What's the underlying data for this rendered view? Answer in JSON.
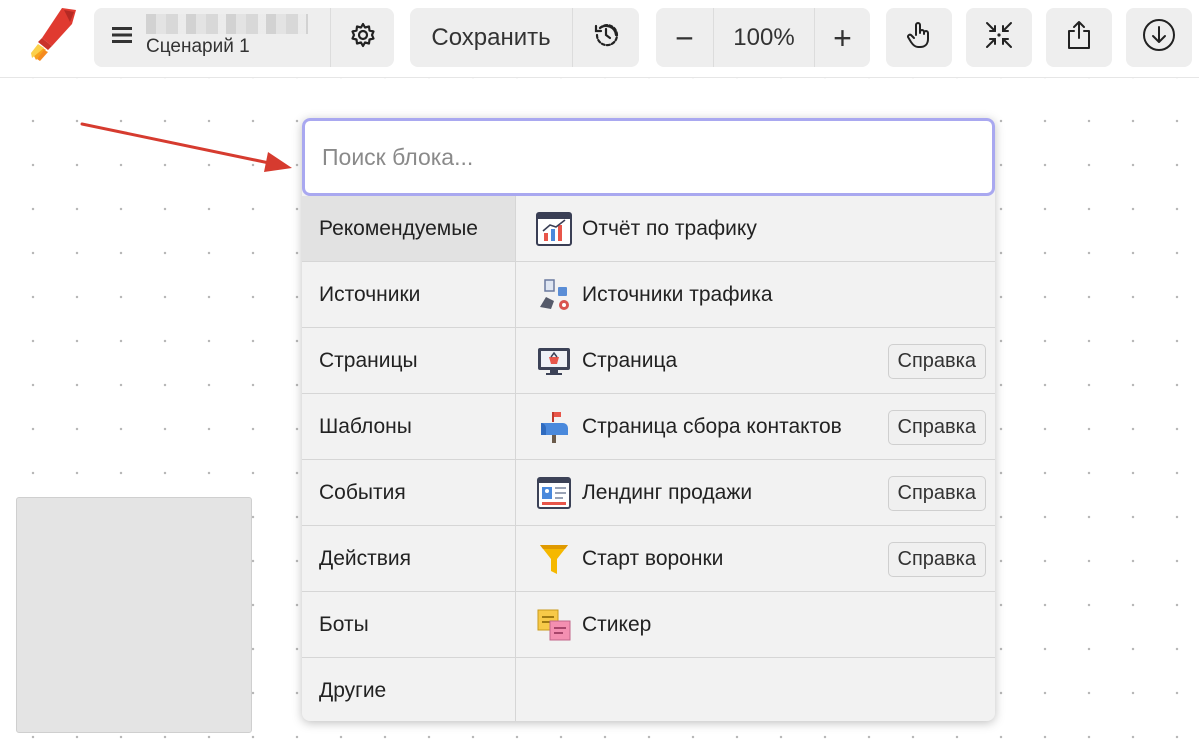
{
  "toolbar": {
    "scenario_name": "Сценарий 1",
    "save_label": "Сохранить",
    "zoom_level": "100%",
    "zoom_out_symbol": "−",
    "zoom_in_symbol": "+",
    "icons": {
      "logo": "rocket-icon",
      "menu": "hamburger-menu-icon",
      "settings": "gear-icon",
      "history": "history-icon",
      "hand": "hand-pointer-icon",
      "fit": "collapse-arrows-icon",
      "share": "share-upload-icon",
      "download": "download-circle-icon"
    }
  },
  "picker": {
    "search_placeholder": "Поиск блока...",
    "categories": [
      {
        "label": "Рекомендуемые",
        "active": true
      },
      {
        "label": "Источники"
      },
      {
        "label": "Страницы"
      },
      {
        "label": "Шаблоны"
      },
      {
        "label": "События"
      },
      {
        "label": "Действия"
      },
      {
        "label": "Боты"
      },
      {
        "label": "Другие"
      }
    ],
    "items": [
      {
        "label": "Отчёт по трафику",
        "icon": "chart-report-icon",
        "help": ""
      },
      {
        "label": "Источники трафика",
        "icon": "traffic-sources-icon",
        "help": ""
      },
      {
        "label": "Страница",
        "icon": "monitor-page-icon",
        "help": "Справка"
      },
      {
        "label": "Страница сбора контактов",
        "icon": "mailbox-icon",
        "help": "Справка"
      },
      {
        "label": "Лендинг продажи",
        "icon": "landing-page-icon",
        "help": "Справка"
      },
      {
        "label": "Старт воронки",
        "icon": "funnel-icon",
        "help": "Справка"
      },
      {
        "label": "Стикер",
        "icon": "sticky-notes-icon",
        "help": ""
      }
    ]
  },
  "colors": {
    "accent_border": "#a9a8f0",
    "arrow": "#d63b2f",
    "toolbar_button_bg": "#eeeeee"
  }
}
